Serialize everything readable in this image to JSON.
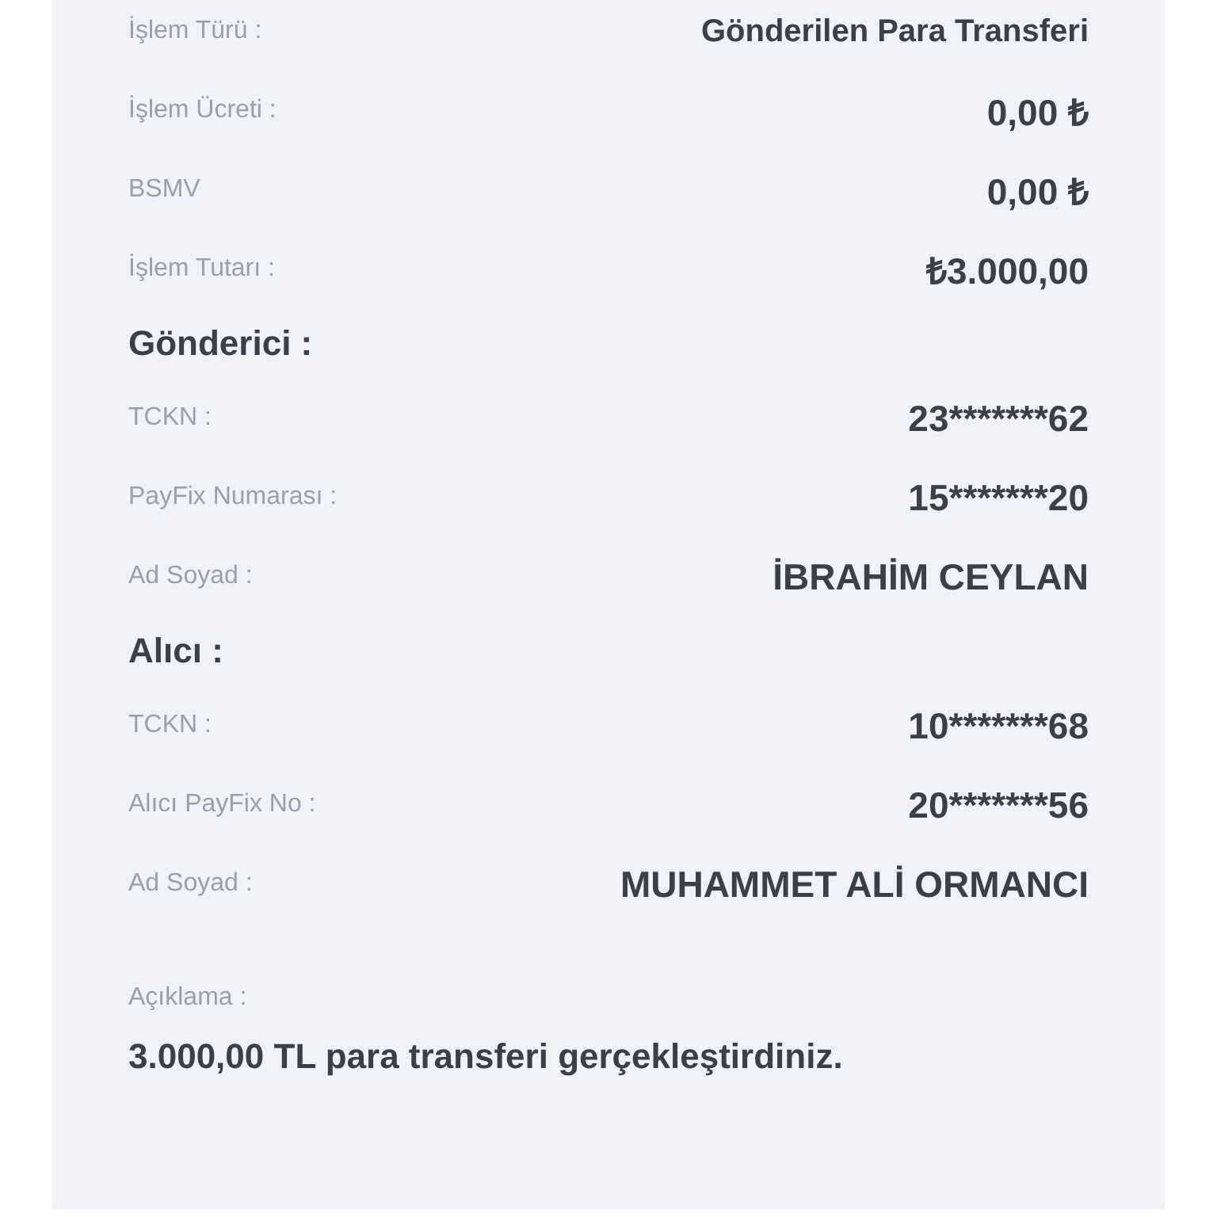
{
  "transaction": [
    {
      "label": "İşlem Türü :",
      "value": "Gönderilen Para Transferi",
      "kind": "text"
    },
    {
      "label": "İşlem Ücreti :",
      "value": "0,00 ₺",
      "kind": "amount"
    },
    {
      "label": "BSMV",
      "value": "0,00 ₺",
      "kind": "amount"
    },
    {
      "label": "İşlem Tutarı :",
      "value": "₺3.000,00",
      "kind": "amount"
    }
  ],
  "sender": {
    "title": "Gönderici :",
    "rows": [
      {
        "label": "TCKN :",
        "value": "23*******62",
        "kind": "amount"
      },
      {
        "label": "PayFix Numarası :",
        "value": "15*******20",
        "kind": "amount"
      },
      {
        "label": "Ad Soyad :",
        "value": "İBRAHİM CEYLAN",
        "kind": "amount"
      }
    ]
  },
  "recipient": {
    "title": "Alıcı :",
    "rows": [
      {
        "label": "TCKN :",
        "value": "10*******68",
        "kind": "amount"
      },
      {
        "label": "Alıcı PayFix No :",
        "value": "20*******56",
        "kind": "amount"
      },
      {
        "label": "Ad Soyad :",
        "value": "MUHAMMET ALİ ORMANCI",
        "kind": "amount"
      }
    ]
  },
  "description": {
    "label": "Açıklama :",
    "text": "3.000,00 TL para transferi gerçekleştirdiniz."
  }
}
